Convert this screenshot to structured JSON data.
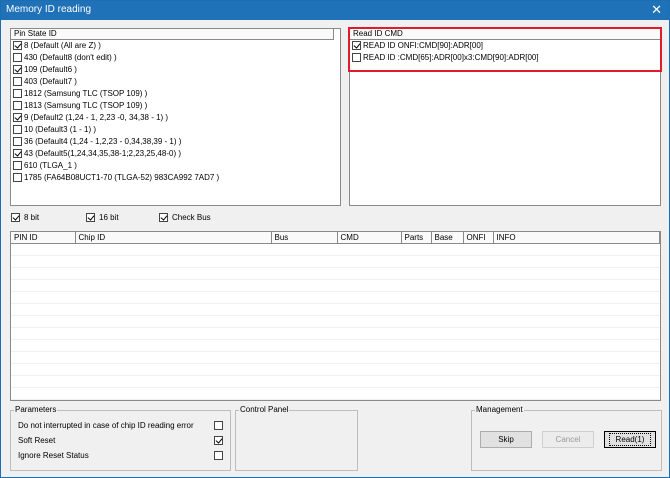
{
  "window": {
    "title": "Memory ID reading",
    "close_glyph": "✕"
  },
  "pin_state": {
    "header": "Pin State ID",
    "items": [
      {
        "label": "8 (Default (All are Z) )",
        "checked": true
      },
      {
        "label": "430 (Default8 (don't edit) )",
        "checked": false
      },
      {
        "label": "109 (Default6 )",
        "checked": true
      },
      {
        "label": "403 (Default7 )",
        "checked": false
      },
      {
        "label": "1812 (Samsung TLC (TSOP 109) )",
        "checked": false
      },
      {
        "label": "1813 (Samsung TLC (TSOP 109) )",
        "checked": false
      },
      {
        "label": "9 (Default2 (1,24 - 1, 2,23 -0, 34,38 - 1) )",
        "checked": true
      },
      {
        "label": "10 (Default3 (1 - 1) )",
        "checked": false
      },
      {
        "label": "36 (Default4 (1,24 - 1,2,23 - 0,34,38,39 - 1) )",
        "checked": false
      },
      {
        "label": "43 (Default5(1,24,34,35,38-1;2,23,25,48-0) )",
        "checked": true
      },
      {
        "label": "610 (TLGA_1 )",
        "checked": false
      },
      {
        "label": "1785 (FA64B08UCT1-70 (TLGA-52) 983CA992 7AD7 )",
        "checked": false
      }
    ]
  },
  "read_cmd": {
    "header": "Read ID CMD",
    "items": [
      {
        "label": "READ ID ONFI:CMD[90]:ADR[00]",
        "checked": true
      },
      {
        "label": "READ ID :CMD[65]:ADR[00]x3:CMD[90]:ADR[00]",
        "checked": false
      }
    ]
  },
  "options": {
    "bit8": {
      "label": "8 bit",
      "checked": true
    },
    "bit16": {
      "label": "16 bit",
      "checked": true
    },
    "check_bus": {
      "label": "Check Bus",
      "checked": true
    }
  },
  "results": {
    "columns": [
      "PIN ID",
      "Chip ID",
      "Bus",
      "CMD",
      "Parts",
      "Base",
      "ONFI",
      "INFO"
    ]
  },
  "parameters": {
    "title": "Parameters",
    "items": [
      {
        "label": "Do not interrupted in case of chip ID reading error",
        "checked": false
      },
      {
        "label": "Soft Reset",
        "checked": true
      },
      {
        "label": "Ignore Reset Status",
        "checked": false
      }
    ]
  },
  "control_panel": {
    "title": "Control Panel"
  },
  "management": {
    "title": "Management",
    "skip_label": "Skip",
    "cancel_label": "Cancel",
    "read_label": "Read(1)"
  }
}
